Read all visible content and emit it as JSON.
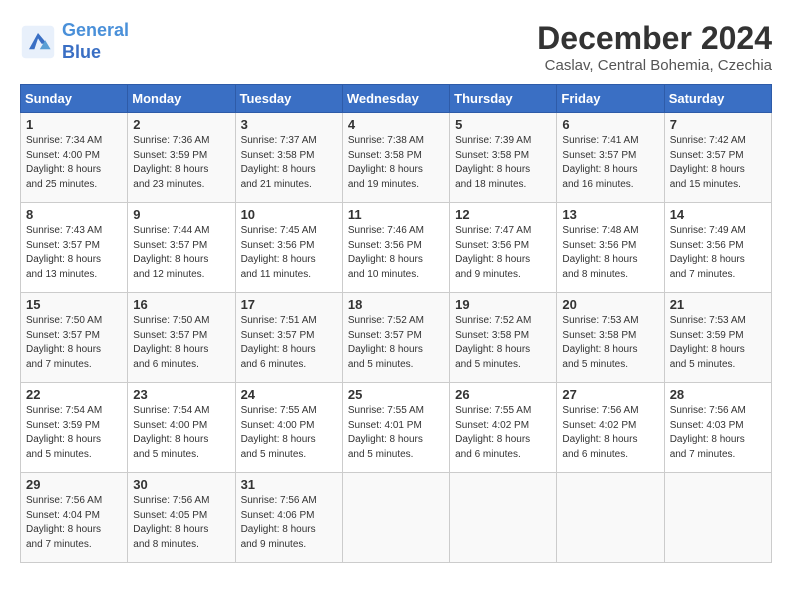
{
  "logo": {
    "line1": "General",
    "line2": "Blue"
  },
  "title": "December 2024",
  "subtitle": "Caslav, Central Bohemia, Czechia",
  "days_of_week": [
    "Sunday",
    "Monday",
    "Tuesday",
    "Wednesday",
    "Thursday",
    "Friday",
    "Saturday"
  ],
  "weeks": [
    [
      {
        "day": "1",
        "info": "Sunrise: 7:34 AM\nSunset: 4:00 PM\nDaylight: 8 hours\nand 25 minutes."
      },
      {
        "day": "2",
        "info": "Sunrise: 7:36 AM\nSunset: 3:59 PM\nDaylight: 8 hours\nand 23 minutes."
      },
      {
        "day": "3",
        "info": "Sunrise: 7:37 AM\nSunset: 3:58 PM\nDaylight: 8 hours\nand 21 minutes."
      },
      {
        "day": "4",
        "info": "Sunrise: 7:38 AM\nSunset: 3:58 PM\nDaylight: 8 hours\nand 19 minutes."
      },
      {
        "day": "5",
        "info": "Sunrise: 7:39 AM\nSunset: 3:58 PM\nDaylight: 8 hours\nand 18 minutes."
      },
      {
        "day": "6",
        "info": "Sunrise: 7:41 AM\nSunset: 3:57 PM\nDaylight: 8 hours\nand 16 minutes."
      },
      {
        "day": "7",
        "info": "Sunrise: 7:42 AM\nSunset: 3:57 PM\nDaylight: 8 hours\nand 15 minutes."
      }
    ],
    [
      {
        "day": "8",
        "info": "Sunrise: 7:43 AM\nSunset: 3:57 PM\nDaylight: 8 hours\nand 13 minutes."
      },
      {
        "day": "9",
        "info": "Sunrise: 7:44 AM\nSunset: 3:57 PM\nDaylight: 8 hours\nand 12 minutes."
      },
      {
        "day": "10",
        "info": "Sunrise: 7:45 AM\nSunset: 3:56 PM\nDaylight: 8 hours\nand 11 minutes."
      },
      {
        "day": "11",
        "info": "Sunrise: 7:46 AM\nSunset: 3:56 PM\nDaylight: 8 hours\nand 10 minutes."
      },
      {
        "day": "12",
        "info": "Sunrise: 7:47 AM\nSunset: 3:56 PM\nDaylight: 8 hours\nand 9 minutes."
      },
      {
        "day": "13",
        "info": "Sunrise: 7:48 AM\nSunset: 3:56 PM\nDaylight: 8 hours\nand 8 minutes."
      },
      {
        "day": "14",
        "info": "Sunrise: 7:49 AM\nSunset: 3:56 PM\nDaylight: 8 hours\nand 7 minutes."
      }
    ],
    [
      {
        "day": "15",
        "info": "Sunrise: 7:50 AM\nSunset: 3:57 PM\nDaylight: 8 hours\nand 7 minutes."
      },
      {
        "day": "16",
        "info": "Sunrise: 7:50 AM\nSunset: 3:57 PM\nDaylight: 8 hours\nand 6 minutes."
      },
      {
        "day": "17",
        "info": "Sunrise: 7:51 AM\nSunset: 3:57 PM\nDaylight: 8 hours\nand 6 minutes."
      },
      {
        "day": "18",
        "info": "Sunrise: 7:52 AM\nSunset: 3:57 PM\nDaylight: 8 hours\nand 5 minutes."
      },
      {
        "day": "19",
        "info": "Sunrise: 7:52 AM\nSunset: 3:58 PM\nDaylight: 8 hours\nand 5 minutes."
      },
      {
        "day": "20",
        "info": "Sunrise: 7:53 AM\nSunset: 3:58 PM\nDaylight: 8 hours\nand 5 minutes."
      },
      {
        "day": "21",
        "info": "Sunrise: 7:53 AM\nSunset: 3:59 PM\nDaylight: 8 hours\nand 5 minutes."
      }
    ],
    [
      {
        "day": "22",
        "info": "Sunrise: 7:54 AM\nSunset: 3:59 PM\nDaylight: 8 hours\nand 5 minutes."
      },
      {
        "day": "23",
        "info": "Sunrise: 7:54 AM\nSunset: 4:00 PM\nDaylight: 8 hours\nand 5 minutes."
      },
      {
        "day": "24",
        "info": "Sunrise: 7:55 AM\nSunset: 4:00 PM\nDaylight: 8 hours\nand 5 minutes."
      },
      {
        "day": "25",
        "info": "Sunrise: 7:55 AM\nSunset: 4:01 PM\nDaylight: 8 hours\nand 5 minutes."
      },
      {
        "day": "26",
        "info": "Sunrise: 7:55 AM\nSunset: 4:02 PM\nDaylight: 8 hours\nand 6 minutes."
      },
      {
        "day": "27",
        "info": "Sunrise: 7:56 AM\nSunset: 4:02 PM\nDaylight: 8 hours\nand 6 minutes."
      },
      {
        "day": "28",
        "info": "Sunrise: 7:56 AM\nSunset: 4:03 PM\nDaylight: 8 hours\nand 7 minutes."
      }
    ],
    [
      {
        "day": "29",
        "info": "Sunrise: 7:56 AM\nSunset: 4:04 PM\nDaylight: 8 hours\nand 7 minutes."
      },
      {
        "day": "30",
        "info": "Sunrise: 7:56 AM\nSunset: 4:05 PM\nDaylight: 8 hours\nand 8 minutes."
      },
      {
        "day": "31",
        "info": "Sunrise: 7:56 AM\nSunset: 4:06 PM\nDaylight: 8 hours\nand 9 minutes."
      },
      null,
      null,
      null,
      null
    ]
  ]
}
